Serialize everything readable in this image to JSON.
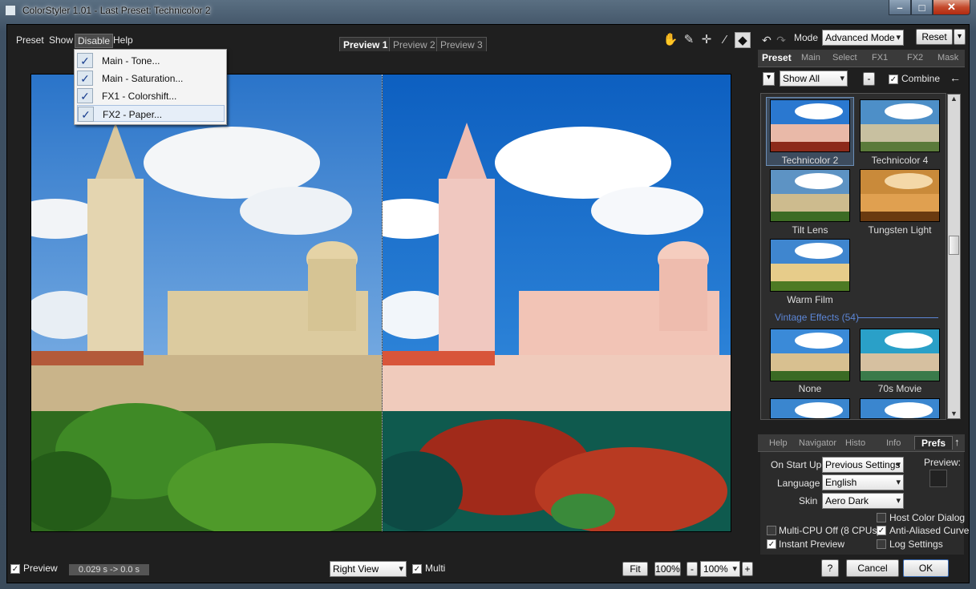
{
  "window": {
    "title": "ColorStyler 1.01 - Last Preset: Technicolor 2",
    "min": "–",
    "max": "□",
    "close": "✕"
  },
  "menu": {
    "preset": "Preset",
    "show": "Show",
    "disable": "Disable",
    "help": "Help"
  },
  "preview_tabs": [
    "Preview 1",
    "Preview 2",
    "Preview 3"
  ],
  "disable_menu": [
    {
      "label": "Main - Tone...",
      "checked": true
    },
    {
      "label": "Main - Saturation...",
      "checked": true
    },
    {
      "label": "FX1 - Colorshift...",
      "checked": true
    },
    {
      "label": "FX2 - Paper...",
      "checked": true
    }
  ],
  "toolbar": {
    "mode_label": "Mode",
    "mode_value": "Advanced Mode",
    "reset": "Reset"
  },
  "right_tabs": [
    "Preset",
    "Main",
    "Select",
    "FX1",
    "FX2",
    "Mask"
  ],
  "preset_filter": {
    "value": "Show All",
    "minus": "-",
    "combine": "Combine"
  },
  "presets": [
    {
      "name": "Technicolor 2",
      "selected": true
    },
    {
      "name": "Technicolor 4"
    },
    {
      "name": "Tilt Lens"
    },
    {
      "name": "Tungsten Light"
    },
    {
      "name": "Warm Film"
    }
  ],
  "vintage_group": "Vintage Effects (54)",
  "vintage_presets": [
    {
      "name": "None"
    },
    {
      "name": "70s Movie"
    }
  ],
  "info_tabs": [
    "Help",
    "Navigator",
    "Histo",
    "Info",
    "Prefs"
  ],
  "prefs": {
    "on_start_up_label": "On Start Up",
    "on_start_up_value": "Previous Settings",
    "language_label": "Language",
    "language_value": "English",
    "skin_label": "Skin",
    "skin_value": "Aero Dark",
    "preview_label": "Preview:",
    "host_color_dialog": "Host Color Dialog",
    "multi_cpu": "Multi-CPU Off (8 CPUs)",
    "anti_aliased": "Anti-Aliased Curve",
    "instant_preview": "Instant Preview",
    "log_settings": "Log Settings"
  },
  "bottom": {
    "preview": "Preview",
    "timing": "0.029 s -> 0.0 s",
    "view": "Right View",
    "multi": "Multi",
    "fit": "Fit",
    "zoom1": "100%",
    "minus": "-",
    "zoom2": "100%",
    "plus": "+",
    "help": "?",
    "cancel": "Cancel",
    "ok": "OK"
  },
  "colors": {
    "accent": "#7ea8d8",
    "group": "#5c86d6",
    "panel": "#2b2b2b"
  }
}
